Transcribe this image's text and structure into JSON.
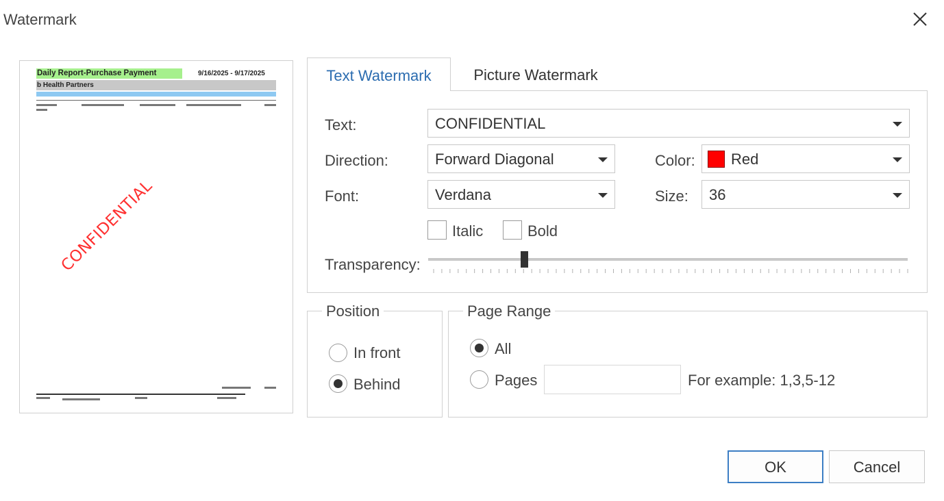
{
  "window": {
    "title": "Watermark"
  },
  "preview": {
    "report_title": "Daily Report-Purchase Payment",
    "date_range": "9/16/2025 - 9/17/2025",
    "subheader": "b Health Partners",
    "watermark_text": "CONFIDENTIAL"
  },
  "tabs": [
    {
      "label": "Text Watermark",
      "active": true
    },
    {
      "label": "Picture Watermark",
      "active": false
    }
  ],
  "text_tab": {
    "text_label": "Text:",
    "text_value": "CONFIDENTIAL",
    "direction_label": "Direction:",
    "direction_value": "Forward Diagonal",
    "color_label": "Color:",
    "color_value": "Red",
    "color_hex": "#ff0000",
    "font_label": "Font:",
    "font_value": "Verdana",
    "size_label": "Size:",
    "size_value": "36",
    "italic_label": "Italic",
    "italic_checked": false,
    "bold_label": "Bold",
    "bold_checked": false,
    "transparency_label": "Transparency:",
    "transparency_value": 0.2
  },
  "position": {
    "title": "Position",
    "options": [
      {
        "label": "In front",
        "selected": false
      },
      {
        "label": "Behind",
        "selected": true
      }
    ]
  },
  "page_range": {
    "title": "Page Range",
    "all_label": "All",
    "all_selected": true,
    "pages_label": "Pages",
    "pages_value": "",
    "example_text": "For example: 1,3,5-12"
  },
  "buttons": {
    "ok": "OK",
    "cancel": "Cancel"
  },
  "colors": {
    "accent": "#2b6cb0",
    "preview_header": "#a6f08d",
    "preview_band": "#8ec9f2",
    "watermark": "#ff3030"
  }
}
